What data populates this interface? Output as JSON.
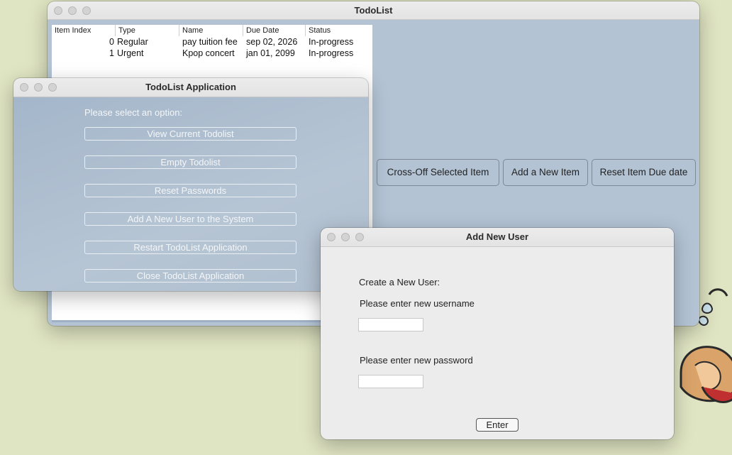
{
  "main_window": {
    "title": "TodoList",
    "columns": [
      "Item Index",
      "Type",
      "Name",
      "Due Date",
      "Status"
    ],
    "rows": [
      {
        "index": "0",
        "type": "Regular",
        "name": "pay tuition fee",
        "due": "sep 02, 2026",
        "status": "In-progress"
      },
      {
        "index": "1",
        "type": "Urgent",
        "name": "Kpop concert",
        "due": "jan 01, 2099",
        "status": "In-progress"
      }
    ],
    "buttons": {
      "cross_off": "Cross-Off Selected Item",
      "add_item": "Add a New Item",
      "reset_due": "Reset Item Due date"
    }
  },
  "app_window": {
    "title": "TodoList Application",
    "prompt": "Please select an option:",
    "options": [
      "View Current Todolist",
      "Empty Todolist",
      "Reset Passwords",
      "Add A New User to the System",
      "Restart TodoList Application",
      "Close TodoList Application"
    ]
  },
  "user_window": {
    "title": "Add New User",
    "heading": "Create a New User:",
    "username_label": "Please enter new username",
    "username_value": "",
    "password_label": "Please enter new password",
    "password_value": "",
    "enter_label": "Enter"
  },
  "colors": {
    "desktop": "#dfe4c2",
    "window_blue": "#b3c3d4",
    "panel_gray": "#ececec"
  }
}
